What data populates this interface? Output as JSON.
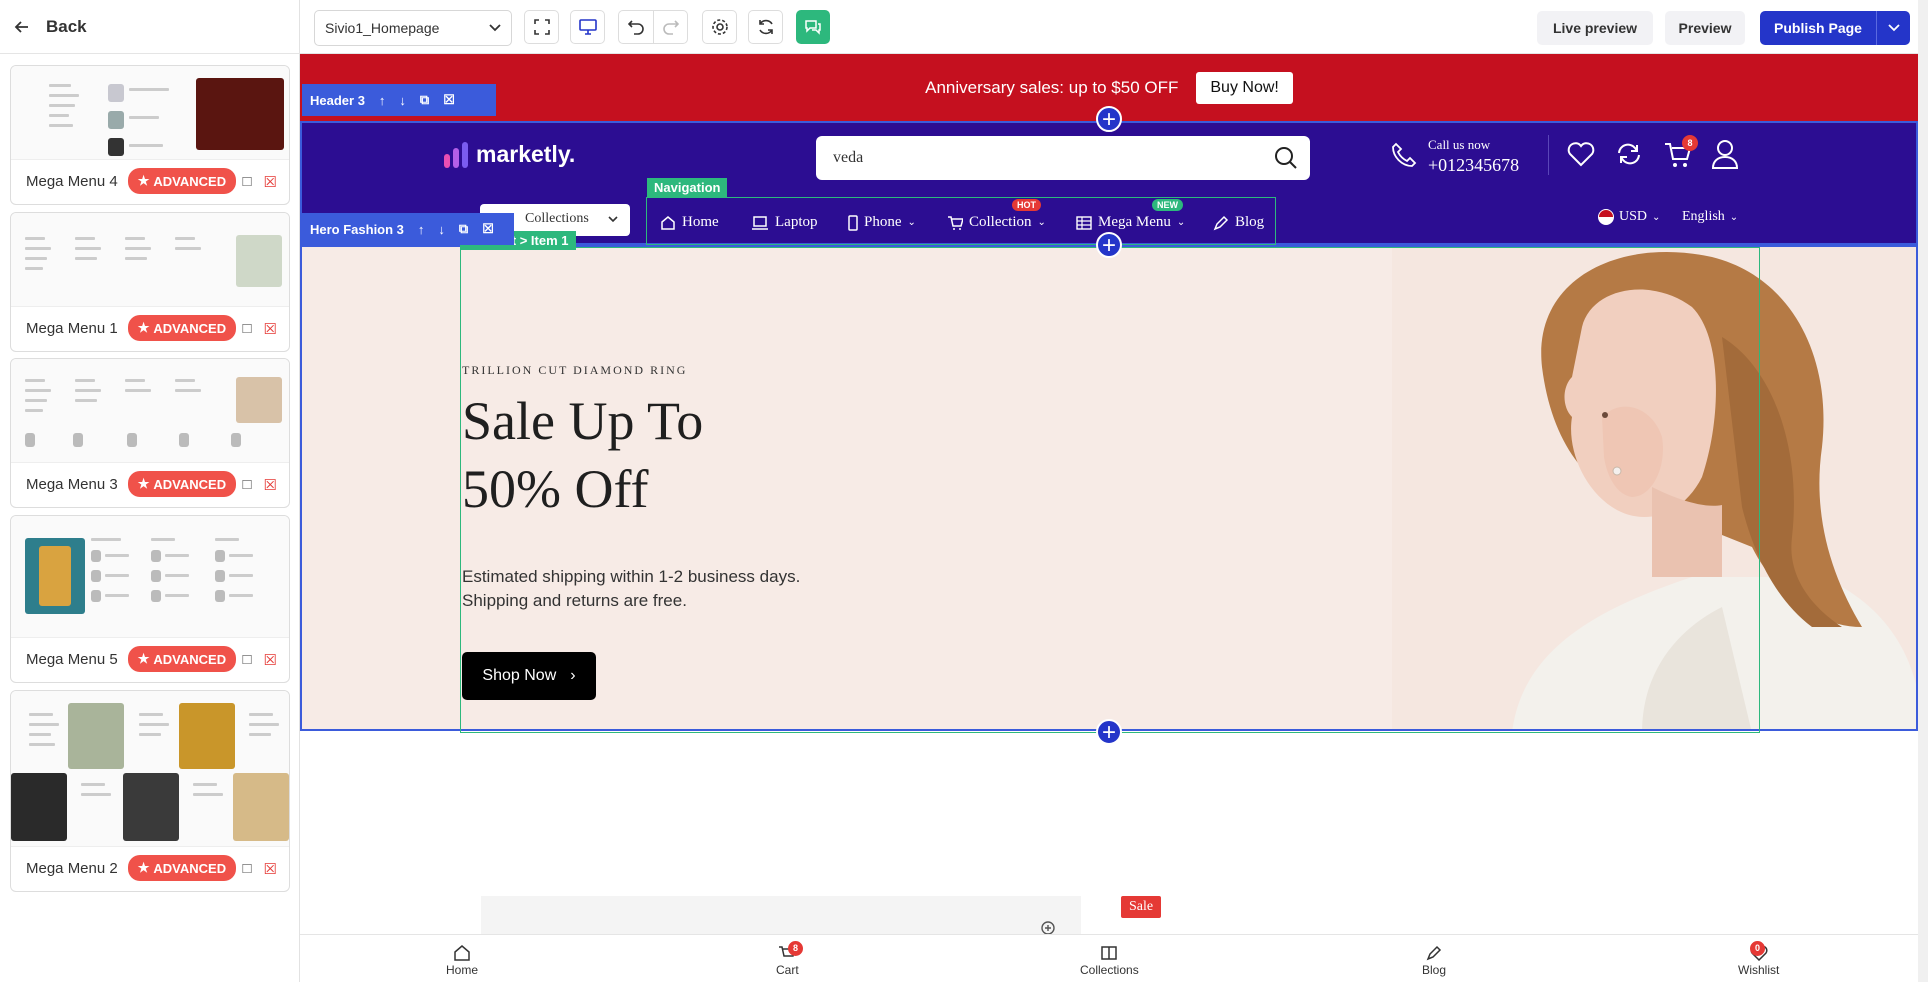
{
  "left_panel": {
    "back_label": "Back",
    "cards": [
      {
        "name": "Mega Menu 4",
        "badge": "ADVANCED"
      },
      {
        "name": "Mega Menu 1",
        "badge": "ADVANCED"
      },
      {
        "name": "Mega Menu 3",
        "badge": "ADVANCED"
      },
      {
        "name": "Mega Menu 5",
        "badge": "ADVANCED"
      },
      {
        "name": "Mega Menu 2",
        "badge": "ADVANCED"
      }
    ]
  },
  "toolbar": {
    "page_select": "Sivio1_Homepage",
    "live_preview": "Live preview",
    "preview": "Preview",
    "publish": "Publish Page"
  },
  "canvas": {
    "announcement": {
      "text": "Anniversary sales: up to $50 OFF",
      "button": "Buy Now!"
    },
    "header_tag": "Header 3",
    "hero_tag": "Hero Fashion 3",
    "navigation_tag": "Navigation",
    "content_tag": "Content > Item 1",
    "header": {
      "logo": "marketly.",
      "search_value": "veda",
      "call_label": "Call us now",
      "phone": "+012345678",
      "cart_count": "8",
      "collections_select": "Collections",
      "nav": [
        {
          "label": "Home"
        },
        {
          "label": "Laptop"
        },
        {
          "label": "Phone"
        },
        {
          "label": "Collection",
          "badge": "HOT"
        },
        {
          "label": "Mega Menu",
          "badge": "NEW"
        },
        {
          "label": "Blog"
        }
      ],
      "currency": "USD",
      "language": "English"
    },
    "hero": {
      "kicker": "TRILLION CUT DIAMOND RING",
      "title_line1": "Sale Up To",
      "title_line2": "50% Off",
      "desc_line1": "Estimated shipping within 1-2 business days.",
      "desc_line2": "Shipping and returns are free.",
      "button": "Shop Now"
    },
    "sale_badge": "Sale",
    "bottom_nav": [
      {
        "label": "Home"
      },
      {
        "label": "Cart",
        "count": "8"
      },
      {
        "label": "Collections"
      },
      {
        "label": "Blog"
      },
      {
        "label": "Wishlist",
        "count": "0"
      }
    ]
  },
  "colors": {
    "announcement_bg": "#c5101f",
    "header_bg": "#2c0d92",
    "selection_blue": "#3b5bdb",
    "green_tag": "#2db87d",
    "advanced_badge": "#f0524a",
    "publish_button": "#2435c9"
  }
}
